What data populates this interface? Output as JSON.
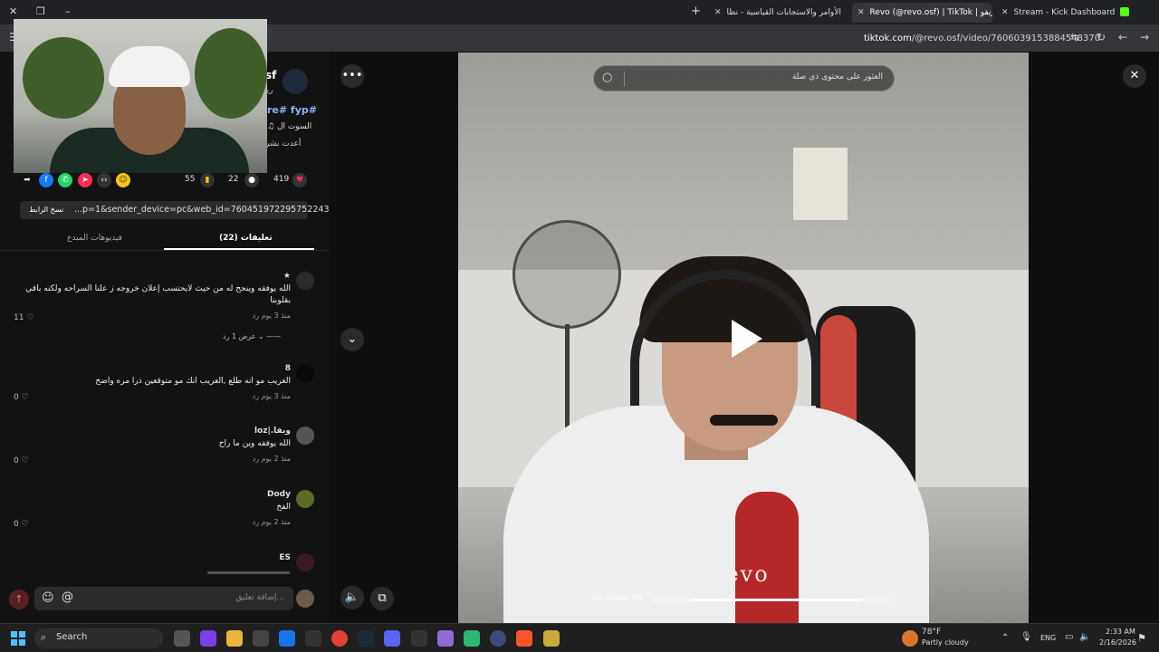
{
  "browser": {
    "tabs": [
      {
        "title": "Stream - Kick Dashboard",
        "active": false
      },
      {
        "title": "Revo (@revo.osf) | TikTok | ريفو",
        "active": true
      },
      {
        "title": "الأوامر والاستجابات القياسية - نظا",
        "active": false
      }
    ],
    "new_tab": "+",
    "url_host": "tiktok.com",
    "url_path": "/@revo.osf/video/7606039153884548370"
  },
  "post": {
    "author_name": "sf",
    "author_sub": "ريـ",
    "hashtags": "re# fyp#",
    "music": "♫ السوت ال",
    "repost": "أعدت نشر",
    "counts": {
      "likes": "419",
      "comments": "22",
      "saves": "55"
    },
    "share_link": "...p=1&sender_device=pc&web_id=7604519722957522439",
    "copy_label": "نسخ الرابط"
  },
  "tabs": {
    "comments": "(22) تعليقات",
    "creator_videos": "فيديوهات المبدع"
  },
  "comments": [
    {
      "user": "★",
      "text_lines": [
        "الله يوفقه وينجح له من حيث لايحتسب إعلان خروجه ز علنا السراحه ولكنه باقي",
        "بقلوبنا"
      ],
      "meta": "منذ 3 يوم   رد",
      "likes": "11 ♡",
      "replies": "عرض 1 رد ⌄  ——"
    },
    {
      "user": "8",
      "text_lines": [
        "الغريب مو انه طلع ,الغريب انك مو متوقعين ذرا مره واضح"
      ],
      "meta": "منذ 3 يوم   رد",
      "likes": "0 ♡"
    },
    {
      "user": "loz|.ويفا",
      "text_lines": [
        "الله يوفقه وين ما راح"
      ],
      "meta": "منذ 2 يوم   رد",
      "likes": "0 ♡"
    },
    {
      "user": "Dody",
      "text_lines": [
        "الفخ"
      ],
      "meta": "منذ 2 يوم   رد",
      "likes": "0 ♡"
    },
    {
      "user": "ES",
      "text_lines": [],
      "meta": "",
      "likes": ""
    }
  ],
  "comment_input": {
    "placeholder": "إضافة تعليق..."
  },
  "video": {
    "watermark": "revo",
    "time": "01:10/00:58",
    "progress": 0.84,
    "search_placeholder": "العثور على محتوى ذي صلة"
  },
  "taskbar": {
    "search_label": "Search",
    "weather_temp": "78°F",
    "weather_desc": "Partly cloudy",
    "lang": "ENG",
    "time": "2:33 AM",
    "date": "2/16/2026"
  },
  "colors": {
    "accent_pink": "#fe2c55",
    "kick_green": "#53fc18"
  }
}
